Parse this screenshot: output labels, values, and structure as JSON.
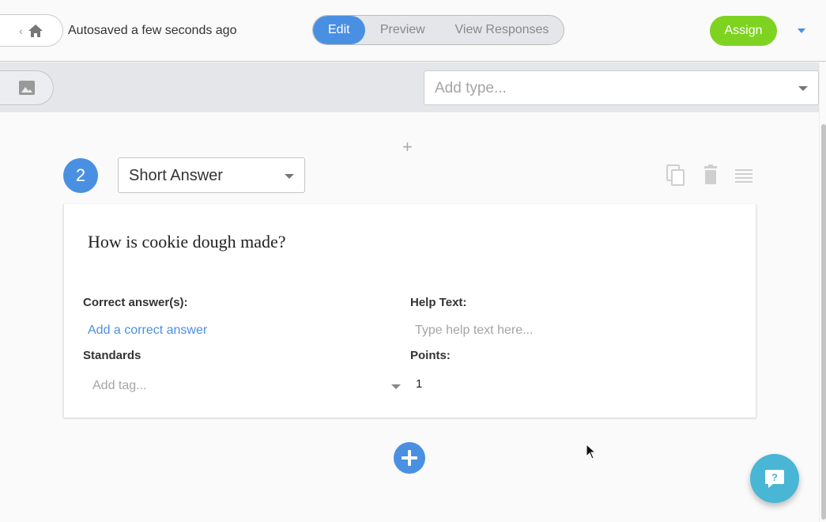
{
  "header": {
    "home_icon": "home-icon",
    "back_icon": "chevron-left-icon",
    "autosave_text": "Autosaved a few seconds ago",
    "tabs": [
      {
        "label": "Edit",
        "active": true
      },
      {
        "label": "Preview",
        "active": false
      },
      {
        "label": "View Responses",
        "active": false
      }
    ],
    "assign_label": "Assign",
    "accent_color": "#4a90e2",
    "assign_color": "#7ed321"
  },
  "toolbar": {
    "image_icon": "image-icon",
    "type_placeholder": "Add type..."
  },
  "question": {
    "number": "2",
    "type": "Short Answer",
    "text": "How is cookie dough made?",
    "actions": [
      "copy-icon",
      "trash-icon",
      "drag-handle-icon"
    ],
    "correct_answers_label": "Correct answer(s):",
    "add_correct_answer": "Add a correct answer",
    "help_text_label": "Help Text:",
    "help_text_placeholder": "Type help text here...",
    "standards_label": "Standards",
    "tag_placeholder": "Add tag...",
    "points_label": "Points:",
    "points_value": "1"
  },
  "add_between_icon": "plus-icon",
  "add_question_icon": "plus-circle-icon",
  "help_fab_icon": "help-chat-icon"
}
